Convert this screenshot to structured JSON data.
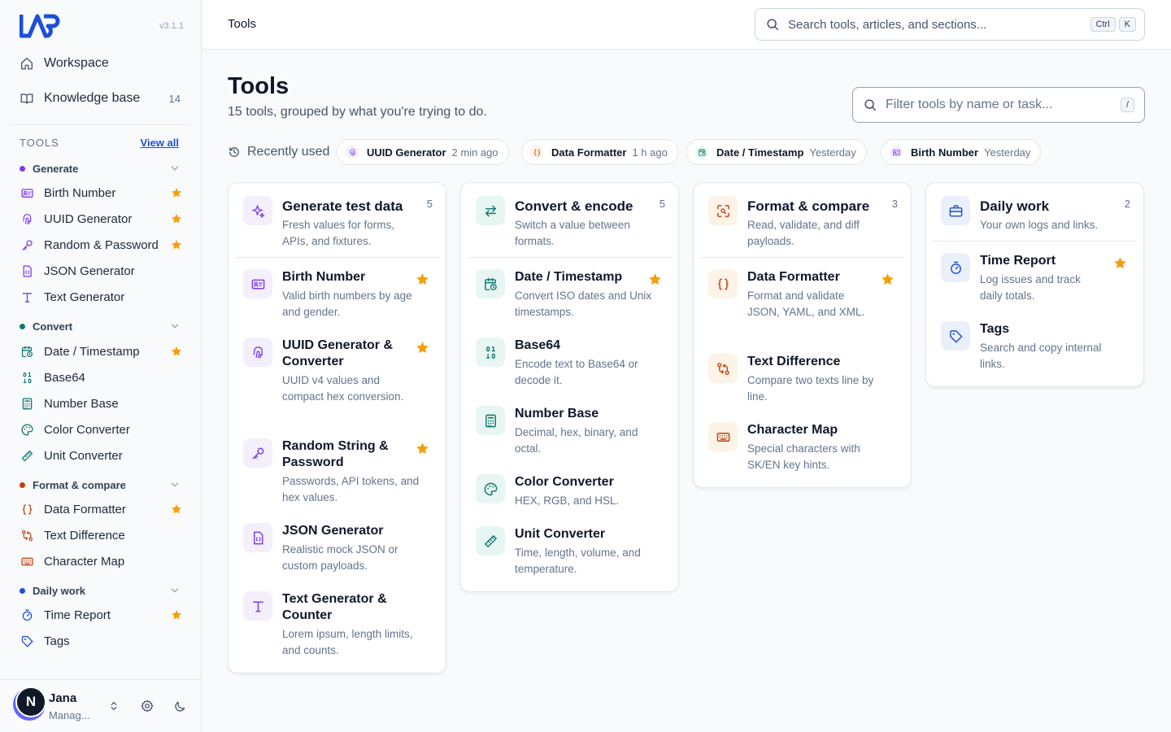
{
  "app": {
    "version": "v3.1.1",
    "nav": [
      {
        "label": "Workspace",
        "icon": "home-icon"
      },
      {
        "label": "Knowledge base",
        "icon": "book-icon",
        "count": "14"
      }
    ]
  },
  "sidebar": {
    "tools_label": "TOOLS",
    "view_all": "View all",
    "groups": [
      {
        "label": "Convert",
        "color": "#16a34a"
      },
      {
        "label": "Generate",
        "color": "#7c3aed"
      },
      {
        "label": "Format & compare",
        "color": "#c2410c"
      },
      {
        "label": "Daily work",
        "color": "#1d4ed8"
      }
    ],
    "generate_items": [
      "Birth Number",
      "UUID Generator",
      "Random & Password",
      "JSON Generator",
      "Text Generator"
    ],
    "convert_items": [
      "Date / Timestamp",
      "Base64",
      "Number Base",
      "Color Converter",
      "Unit Converter"
    ],
    "format_items": [
      "Data Formatter",
      "Text Difference",
      "Character Map"
    ],
    "daily_items": [
      "Time Report",
      "Tags"
    ]
  },
  "user": {
    "initial": "N",
    "name": "Jana",
    "role": "Manag..."
  },
  "topbar": {
    "breadcrumb": "Tools",
    "search_placeholder": "Search tools, articles, and sections...",
    "shortcut_1": "Ctrl",
    "shortcut_2": "K"
  },
  "page": {
    "title": "Tools",
    "subtitle": "15 tools, grouped by what you're trying to do.",
    "filter_placeholder": "Filter tools by name or task...",
    "filter_shortcut": "/"
  },
  "recent": {
    "label": "Recently used",
    "chips": [
      {
        "name": "UUID Generator",
        "time": "2 min ago"
      },
      {
        "name": "Data Formatter",
        "time": "1 h ago"
      },
      {
        "name": "Date / Timestamp",
        "time": "Yesterday"
      },
      {
        "name": "Birth Number",
        "time": "Yesterday"
      }
    ]
  },
  "cards": {
    "generate": {
      "title": "Generate test data",
      "desc": "Fresh values for forms, APIs, and fixtures.",
      "count": "5",
      "tools": [
        {
          "title": "Birth Number",
          "desc": "Valid birth numbers by age and gender."
        },
        {
          "title": "UUID Generator & Converter",
          "desc": "UUID v4 values and compact hex conversion."
        },
        {
          "title": "Random String & Password",
          "desc": "Passwords, API tokens, and hex values."
        },
        {
          "title": "JSON Generator",
          "desc": "Realistic mock JSON or custom payloads."
        },
        {
          "title": "Text Generator & Counter",
          "desc": "Lorem ipsum, length limits, and counts."
        }
      ]
    },
    "convert": {
      "title": "Convert & encode",
      "desc": "Switch a value between formats.",
      "count": "5",
      "tools": [
        {
          "title": "Date / Timestamp",
          "desc": "Convert ISO dates and Unix timestamps."
        },
        {
          "title": "Base64",
          "desc": "Encode text to Base64 or decode it."
        },
        {
          "title": "Number Base",
          "desc": "Decimal, hex, binary, and octal."
        },
        {
          "title": "Color Converter",
          "desc": "HEX, RGB, and HSL."
        },
        {
          "title": "Unit Converter",
          "desc": "Time, length, volume, and temperature."
        }
      ]
    },
    "format": {
      "title": "Format & compare",
      "desc": "Read, validate, and diff payloads.",
      "count": "3",
      "tools": [
        {
          "title": "Data Formatter",
          "desc": "Format and validate JSON, YAML, and XML."
        },
        {
          "title": "Text Difference",
          "desc": "Compare two texts line by line."
        },
        {
          "title": "Character Map",
          "desc": "Special characters with SK/EN key hints."
        }
      ]
    },
    "daily": {
      "title": "Daily work",
      "desc": "Your own logs and links.",
      "count": "2",
      "tools": [
        {
          "title": "Time Report",
          "desc": "Log issues and track daily totals."
        },
        {
          "title": "Tags",
          "desc": "Search and copy internal links."
        }
      ]
    }
  },
  "colors": {
    "accent": "#1d4ed8",
    "star": "#f59e0b",
    "generate": "#7c3aed",
    "convert": "#0f766e",
    "format": "#c2410c",
    "daily": "#1d4ed8"
  }
}
